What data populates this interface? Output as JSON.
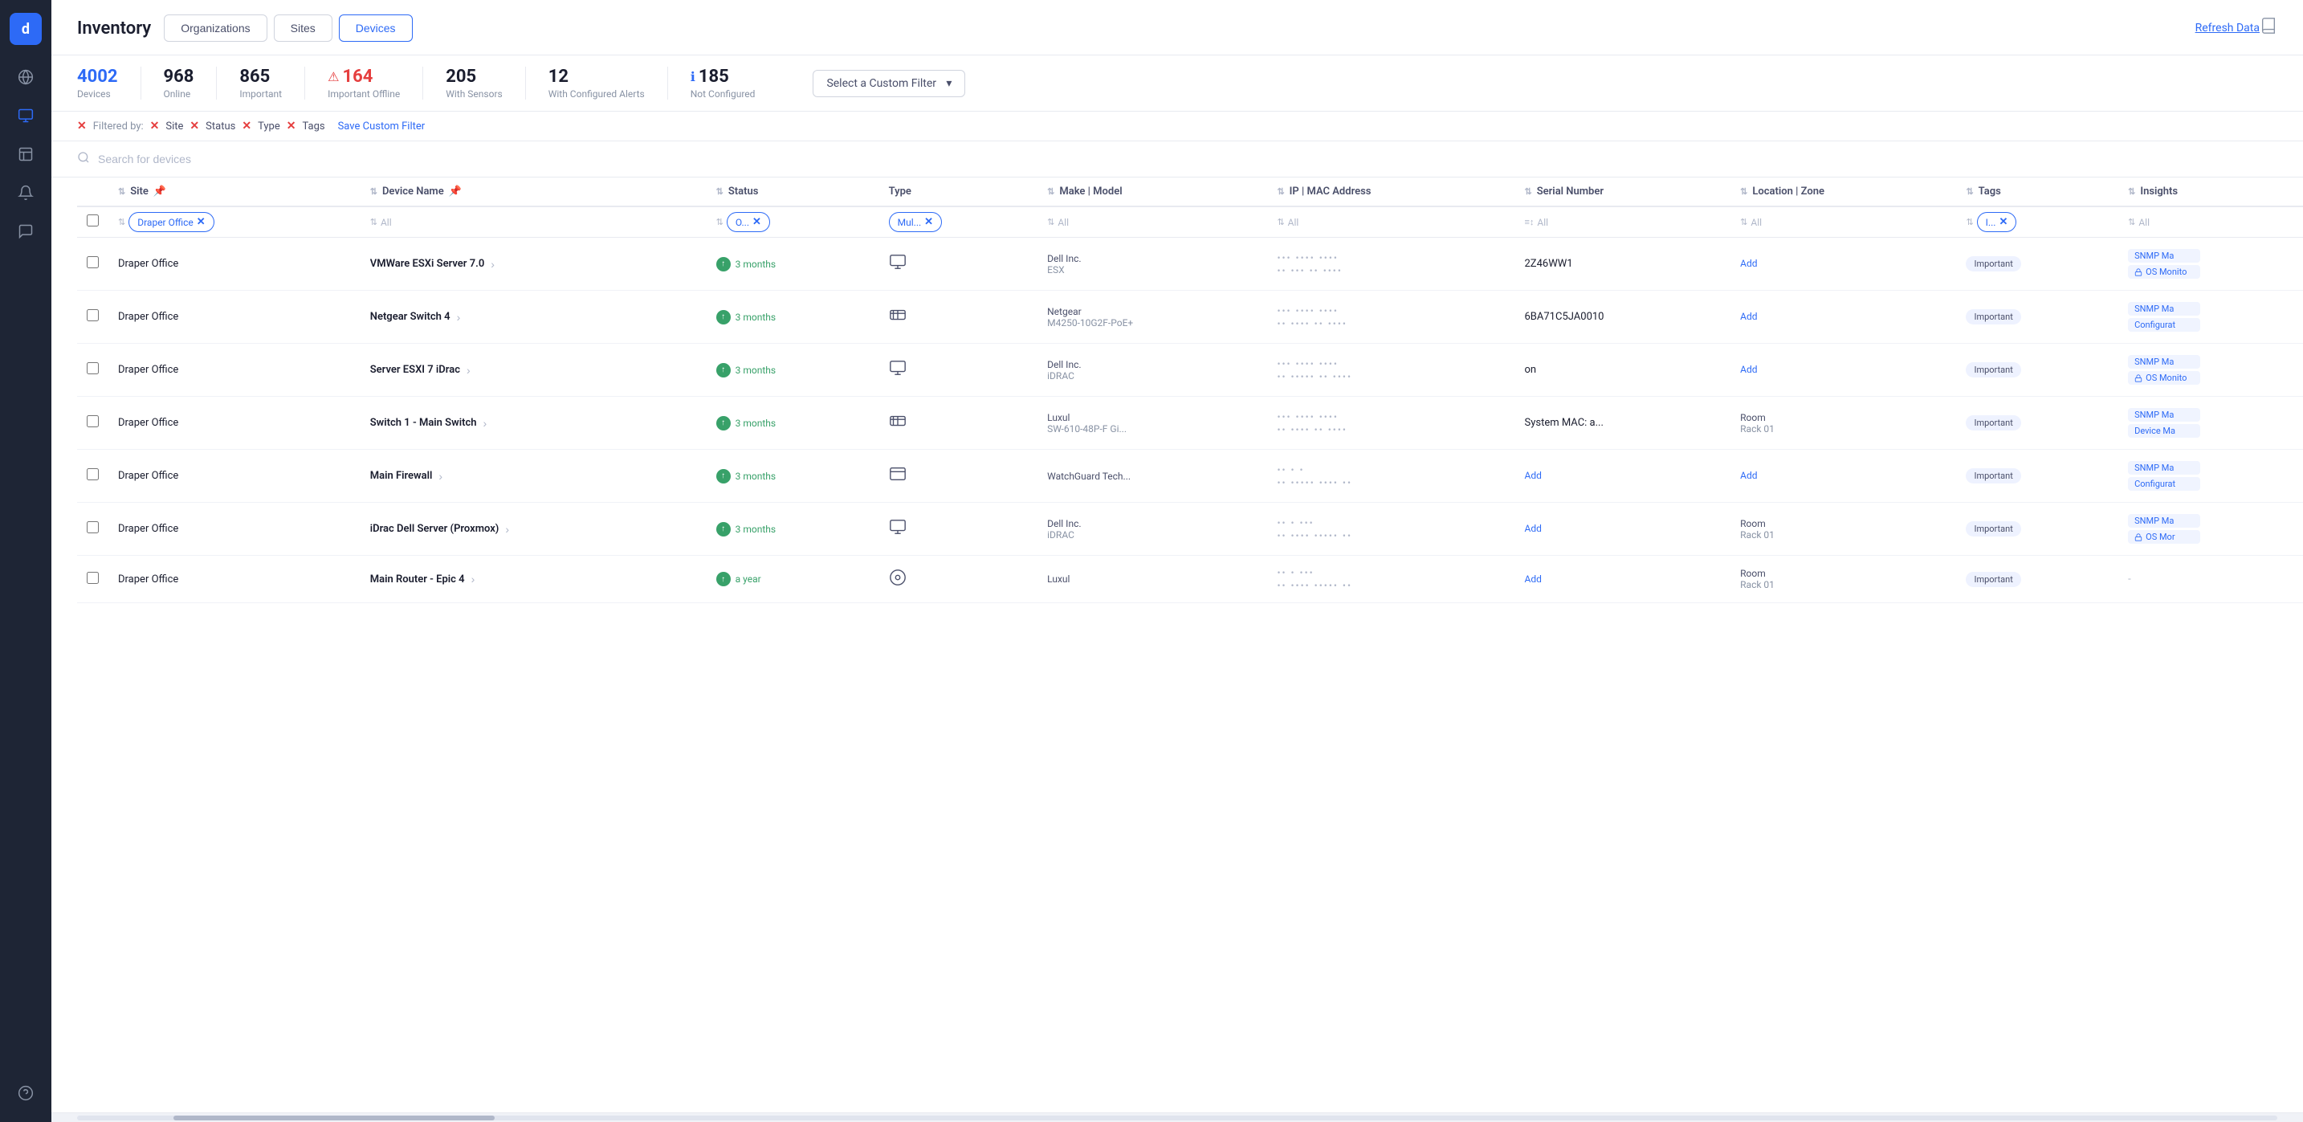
{
  "app": {
    "logo": "d",
    "title": "Inventory"
  },
  "header": {
    "title": "Inventory",
    "refresh_label": "Refresh Data",
    "book_icon": "📖"
  },
  "tabs": [
    {
      "id": "organizations",
      "label": "Organizations",
      "active": false
    },
    {
      "id": "sites",
      "label": "Sites",
      "active": false
    },
    {
      "id": "devices",
      "label": "Devices",
      "active": true
    }
  ],
  "stats": [
    {
      "id": "total",
      "value": "4002",
      "label": "Devices",
      "color": "blue"
    },
    {
      "id": "online",
      "value": "968",
      "label": "Online",
      "color": "default"
    },
    {
      "id": "important",
      "value": "865",
      "label": "Important",
      "color": "default"
    },
    {
      "id": "important-offline",
      "value": "164",
      "label": "Important Offline",
      "color": "red",
      "has_icon": true
    },
    {
      "id": "with-sensors",
      "value": "205",
      "label": "With Sensors",
      "color": "default"
    },
    {
      "id": "configured-alerts",
      "value": "12",
      "label": "With Configured Alerts",
      "color": "default"
    },
    {
      "id": "not-configured",
      "value": "185",
      "label": "Not Configured",
      "color": "default",
      "has_icon": true
    }
  ],
  "custom_filter": {
    "placeholder": "Select a Custom Filter",
    "chevron": "▾"
  },
  "filters": {
    "label": "Filtered by:",
    "items": [
      {
        "id": "site-filter",
        "label": "Site"
      },
      {
        "id": "status-filter",
        "label": "Status"
      },
      {
        "id": "type-filter",
        "label": "Type"
      },
      {
        "id": "tags-filter",
        "label": "Tags"
      }
    ],
    "save_label": "Save Custom Filter"
  },
  "search": {
    "placeholder": "Search for devices"
  },
  "table": {
    "columns": [
      {
        "id": "site",
        "label": "Site",
        "has_pin": true
      },
      {
        "id": "device-name",
        "label": "Device Name",
        "has_pin": true
      },
      {
        "id": "status",
        "label": "Status"
      },
      {
        "id": "type",
        "label": "Type"
      },
      {
        "id": "make-model",
        "label": "Make | Model"
      },
      {
        "id": "ip-mac",
        "label": "IP | MAC Address"
      },
      {
        "id": "serial",
        "label": "Serial Number"
      },
      {
        "id": "location",
        "label": "Location | Zone"
      },
      {
        "id": "tags",
        "label": "Tags"
      },
      {
        "id": "insights",
        "label": "Insights"
      }
    ],
    "col_filters": {
      "site": "Draper Office",
      "device_name": "All",
      "status": "O...",
      "type": "Mul...",
      "make_model": "All",
      "ip_mac": "All",
      "serial": "All",
      "location": "All",
      "tags": "I...",
      "insights": "All"
    },
    "rows": [
      {
        "id": "row-1",
        "site": "Draper Office",
        "device_name": "VMWare ESXi Server 7.0",
        "status": "3 months",
        "type_icon": "🖥",
        "make": "Dell Inc.",
        "model": "ESX",
        "ip1": "••• •••• ••••",
        "ip2": "•• ••• •• ••••",
        "serial": "2Z46WW1",
        "location": "",
        "zone": "",
        "tags": "Important",
        "insights": [
          "SNMP Ma",
          "OS Monito"
        ]
      },
      {
        "id": "row-2",
        "site": "Draper Office",
        "device_name": "Netgear Switch 4",
        "status": "3 months",
        "type_icon": "🔀",
        "make": "Netgear",
        "model": "M4250-10G2F-PoE+",
        "ip1": "••• •••• ••••",
        "ip2": "•• •••• •• ••••",
        "serial": "6BA71C5JA0010",
        "location": "",
        "zone": "",
        "tags": "Important",
        "insights": [
          "SNMP Ma",
          "Configurat"
        ]
      },
      {
        "id": "row-3",
        "site": "Draper Office",
        "device_name": "Server ESXI 7 iDrac",
        "status": "3 months",
        "type_icon": "🖥",
        "make": "Dell Inc.",
        "model": "iDRAC",
        "ip1": "••• •••• ••••",
        "ip2": "•• ••••• •• ••••",
        "serial": "on",
        "location": "",
        "zone": "",
        "tags": "Important",
        "insights": [
          "SNMP Ma",
          "OS Monito"
        ]
      },
      {
        "id": "row-4",
        "site": "Draper Office",
        "device_name": "Switch 1 - Main Switch",
        "status": "3 months",
        "type_icon": "🔀",
        "make": "Luxul",
        "model": "SW-610-48P-F Gi...",
        "ip1": "••• •••• ••••",
        "ip2": "•• •••• •• ••••",
        "serial": "System MAC: a...",
        "location": "Room",
        "zone": "Rack 01",
        "tags": "Important",
        "insights": [
          "SNMP Ma",
          "Device Ma"
        ]
      },
      {
        "id": "row-5",
        "site": "Draper Office",
        "device_name": "Main Firewall",
        "status": "3 months",
        "type_icon": "🔲",
        "make": "WatchGuard Tech...",
        "model": "",
        "ip1": "•• • •",
        "ip2": "•• ••••• •••• ••",
        "serial": "Add",
        "serial_is_link": true,
        "location": "",
        "zone": "",
        "tags": "Important",
        "insights": [
          "SNMP Ma",
          "Configurat"
        ]
      },
      {
        "id": "row-6",
        "site": "Draper Office",
        "device_name": "iDrac Dell Server (Proxmox)",
        "status": "3 months",
        "type_icon": "🖥",
        "make": "Dell Inc.",
        "model": "iDRAC",
        "ip1": "•• • •••",
        "ip2": "•• •••• ••••• ••",
        "serial": "Add",
        "serial_is_link": true,
        "location": "Room",
        "zone": "Rack 01",
        "tags": "Important",
        "insights": [
          "SNMP Ma",
          "OS Mor"
        ]
      },
      {
        "id": "row-7",
        "site": "Draper Office",
        "device_name": "Main Router - Epic 4",
        "status": "a year",
        "type_icon": "⊙",
        "make": "Luxul",
        "model": "",
        "ip1": "•• • •••",
        "ip2": "•• •••• ••••• ••",
        "serial": "Add",
        "serial_is_link": true,
        "location": "Room",
        "zone": "Rack 01",
        "tags": "Important",
        "insights": [
          "-"
        ]
      }
    ]
  },
  "sidebar_icons": [
    {
      "id": "globe",
      "icon": "🌐",
      "active": false
    },
    {
      "id": "inventory",
      "icon": "⬡",
      "active": true
    },
    {
      "id": "reports",
      "icon": "📊",
      "active": false
    },
    {
      "id": "monitoring",
      "icon": "🔔",
      "active": false
    },
    {
      "id": "network",
      "icon": "💬",
      "active": false
    },
    {
      "id": "support",
      "icon": "❓",
      "active": false
    }
  ]
}
